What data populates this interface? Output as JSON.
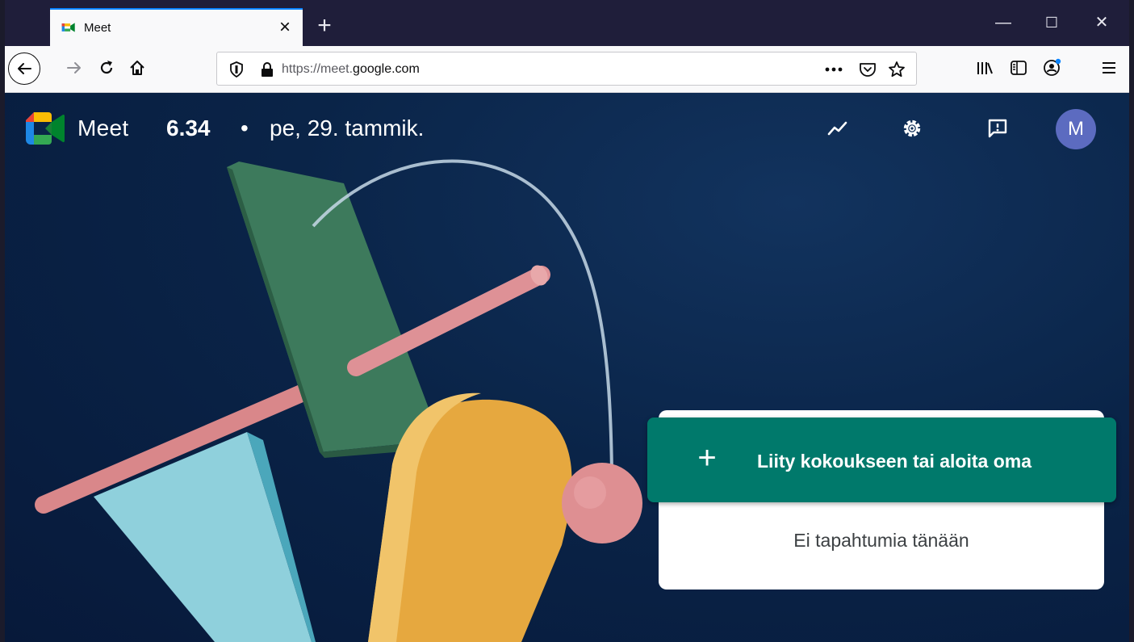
{
  "browser": {
    "tab": {
      "title": "Meet",
      "close": "×"
    },
    "new_tab": "+",
    "window": {
      "minimize": "—",
      "maximize": "☐",
      "close": "✕"
    },
    "url": {
      "scheme": "https://meet.",
      "domain": "google.com"
    }
  },
  "meet": {
    "brand": "Meet",
    "time": "6.34",
    "separator": "•",
    "date": "pe, 29. tammik.",
    "avatar_letter": "M",
    "join_button": {
      "icon": "+",
      "label": "Liity kokoukseen tai aloita oma"
    },
    "no_events": "Ei tapahtumia tänään"
  },
  "colors": {
    "page_bg": "#0a2448",
    "join_green": "#00796b",
    "avatar": "#5c6bc0",
    "tab_accent": "#0a84ff"
  },
  "icons": {
    "header": [
      "activity-icon",
      "settings-gear-icon",
      "feedback-icon"
    ],
    "nav": [
      "back-arrow-icon",
      "forward-arrow-icon",
      "reload-icon",
      "home-icon",
      "tracking-shield-icon",
      "lock-icon",
      "more-dots-icon",
      "pocket-icon",
      "star-icon",
      "library-icon",
      "sidebar-icon",
      "account-icon",
      "menu-icon"
    ]
  }
}
